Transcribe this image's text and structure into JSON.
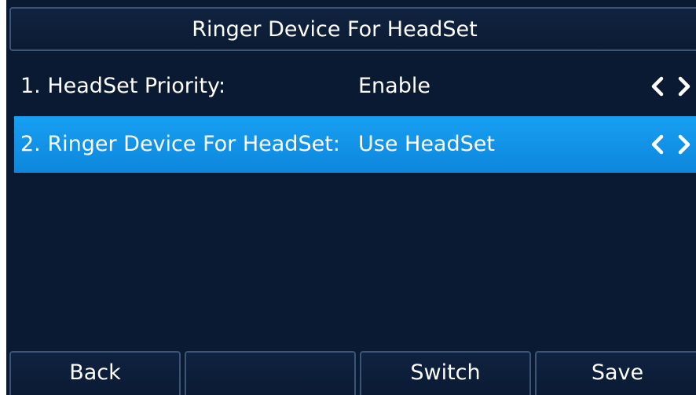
{
  "header": {
    "title": "Ringer Device For HeadSet"
  },
  "menu": {
    "items": [
      {
        "label": "1. HeadSet Priority:",
        "value": "Enable",
        "selected": false
      },
      {
        "label": "2. Ringer Device For HeadSet:",
        "value": "Use HeadSet",
        "selected": true
      }
    ]
  },
  "softkeys": [
    {
      "label": "Back"
    },
    {
      "label": ""
    },
    {
      "label": "Switch"
    },
    {
      "label": "Save"
    }
  ],
  "colors": {
    "background": "#0b1a33",
    "selected_row": "#1296e8",
    "border": "#3a5577",
    "text": "#ffffff"
  },
  "icons": {
    "left": "chevron-left-icon",
    "right": "chevron-right-icon"
  }
}
